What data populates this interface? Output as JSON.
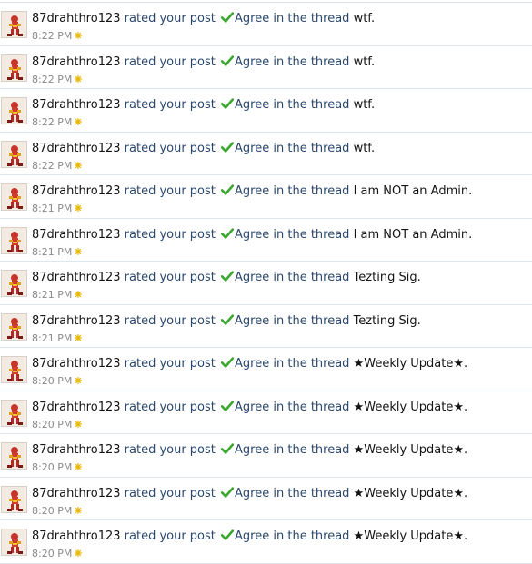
{
  "feed": {
    "items": [
      {
        "user": "87drahthro123",
        "action": "rated your post",
        "rating": "Agree",
        "thread_prefix": "in the thread",
        "thread": "wtf.",
        "time": "8:22 PM"
      },
      {
        "user": "87drahthro123",
        "action": "rated your post",
        "rating": "Agree",
        "thread_prefix": "in the thread",
        "thread": "wtf.",
        "time": "8:22 PM"
      },
      {
        "user": "87drahthro123",
        "action": "rated your post",
        "rating": "Agree",
        "thread_prefix": "in the thread",
        "thread": "wtf.",
        "time": "8:22 PM"
      },
      {
        "user": "87drahthro123",
        "action": "rated your post",
        "rating": "Agree",
        "thread_prefix": "in the thread",
        "thread": "wtf.",
        "time": "8:22 PM"
      },
      {
        "user": "87drahthro123",
        "action": "rated your post",
        "rating": "Agree",
        "thread_prefix": "in the thread",
        "thread": "I am NOT an Admin.",
        "time": "8:21 PM"
      },
      {
        "user": "87drahthro123",
        "action": "rated your post",
        "rating": "Agree",
        "thread_prefix": "in the thread",
        "thread": "I am NOT an Admin.",
        "time": "8:21 PM"
      },
      {
        "user": "87drahthro123",
        "action": "rated your post",
        "rating": "Agree",
        "thread_prefix": "in the thread",
        "thread": "Tezting Sig.",
        "time": "8:21 PM"
      },
      {
        "user": "87drahthro123",
        "action": "rated your post",
        "rating": "Agree",
        "thread_prefix": "in the thread",
        "thread": "Tezting Sig.",
        "time": "8:21 PM"
      },
      {
        "user": "87drahthro123",
        "action": "rated your post",
        "rating": "Agree",
        "thread_prefix": "in the thread",
        "thread": "★Weekly Update★.",
        "time": "8:20 PM"
      },
      {
        "user": "87drahthro123",
        "action": "rated your post",
        "rating": "Agree",
        "thread_prefix": "in the thread",
        "thread": "★Weekly Update★.",
        "time": "8:20 PM"
      },
      {
        "user": "87drahthro123",
        "action": "rated your post",
        "rating": "Agree",
        "thread_prefix": "in the thread",
        "thread": "★Weekly Update★.",
        "time": "8:20 PM"
      },
      {
        "user": "87drahthro123",
        "action": "rated your post",
        "rating": "Agree",
        "thread_prefix": "in the thread",
        "thread": "★Weekly Update★.",
        "time": "8:20 PM"
      },
      {
        "user": "87drahthro123",
        "action": "rated your post",
        "rating": "Agree",
        "thread_prefix": "in the thread",
        "thread": "★Weekly Update★.",
        "time": "8:20 PM"
      }
    ]
  },
  "icons": {
    "rating_icon": "check-icon",
    "new_marker_icon": "new-marker-icon",
    "avatar": "avatar"
  },
  "colors": {
    "link": "#2b486e",
    "check": "#3aa82e",
    "timestamp": "#8a8a8a",
    "divider": "#dfe6ee",
    "new_marker": "#e8b800"
  }
}
